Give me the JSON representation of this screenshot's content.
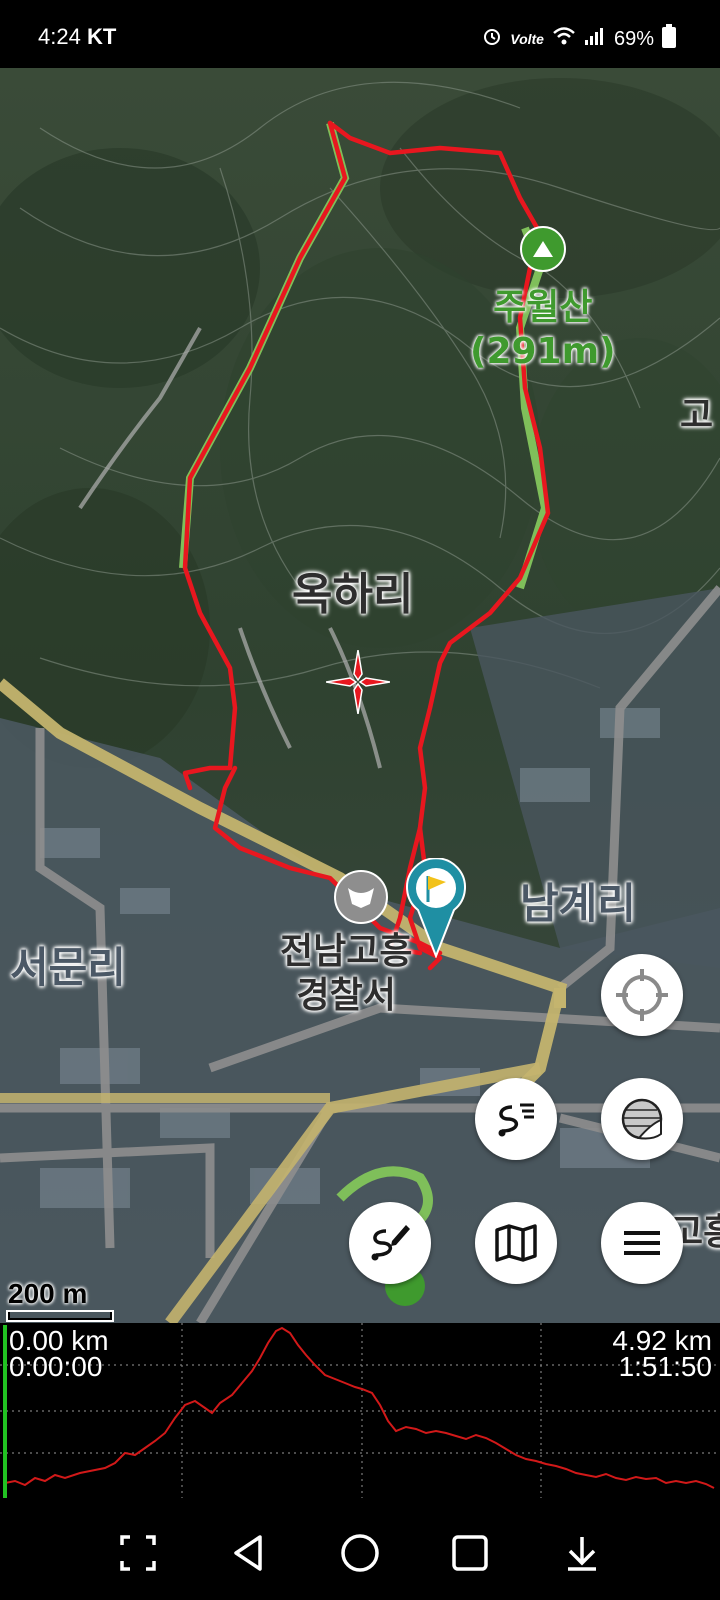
{
  "status_bar": {
    "time": "4:24",
    "carrier": "KT",
    "network": "Volte",
    "battery": "69%",
    "icons": [
      "alarm-icon",
      "volte-icon",
      "wifi-icon",
      "signal-icon",
      "battery-icon"
    ]
  },
  "map": {
    "labels": {
      "peak_name": "주월산",
      "peak_elevation": "(291m)",
      "village_okhari": "옥하리",
      "village_namgyeri": "남계리",
      "village_seomunri": "서문리",
      "police_line1": "전남고흥",
      "police_line2": "경찰서",
      "edge_label_right": "고",
      "edge_label_bottom_right": "고흥"
    },
    "scale_label": "200 m",
    "track_color": "#e8171f",
    "buttons": {
      "locate": "crosshair-locate-icon",
      "route_list": "route-list-icon",
      "map_layer": "map-layer-icon",
      "draw_route": "draw-route-icon",
      "map": "folded-map-icon",
      "menu": "menu-icon"
    }
  },
  "elevation_profile": {
    "start_distance": "0.00 km",
    "start_time": "0:00:00",
    "end_distance": "4.92 km",
    "end_time": "1:51:50",
    "line_color": "#d21919",
    "cursor_color": "#22c322"
  },
  "nav_bar": {
    "buttons": [
      "screenshot-icon",
      "back-icon",
      "home-icon",
      "recents-icon",
      "hide-navbar-icon"
    ]
  }
}
